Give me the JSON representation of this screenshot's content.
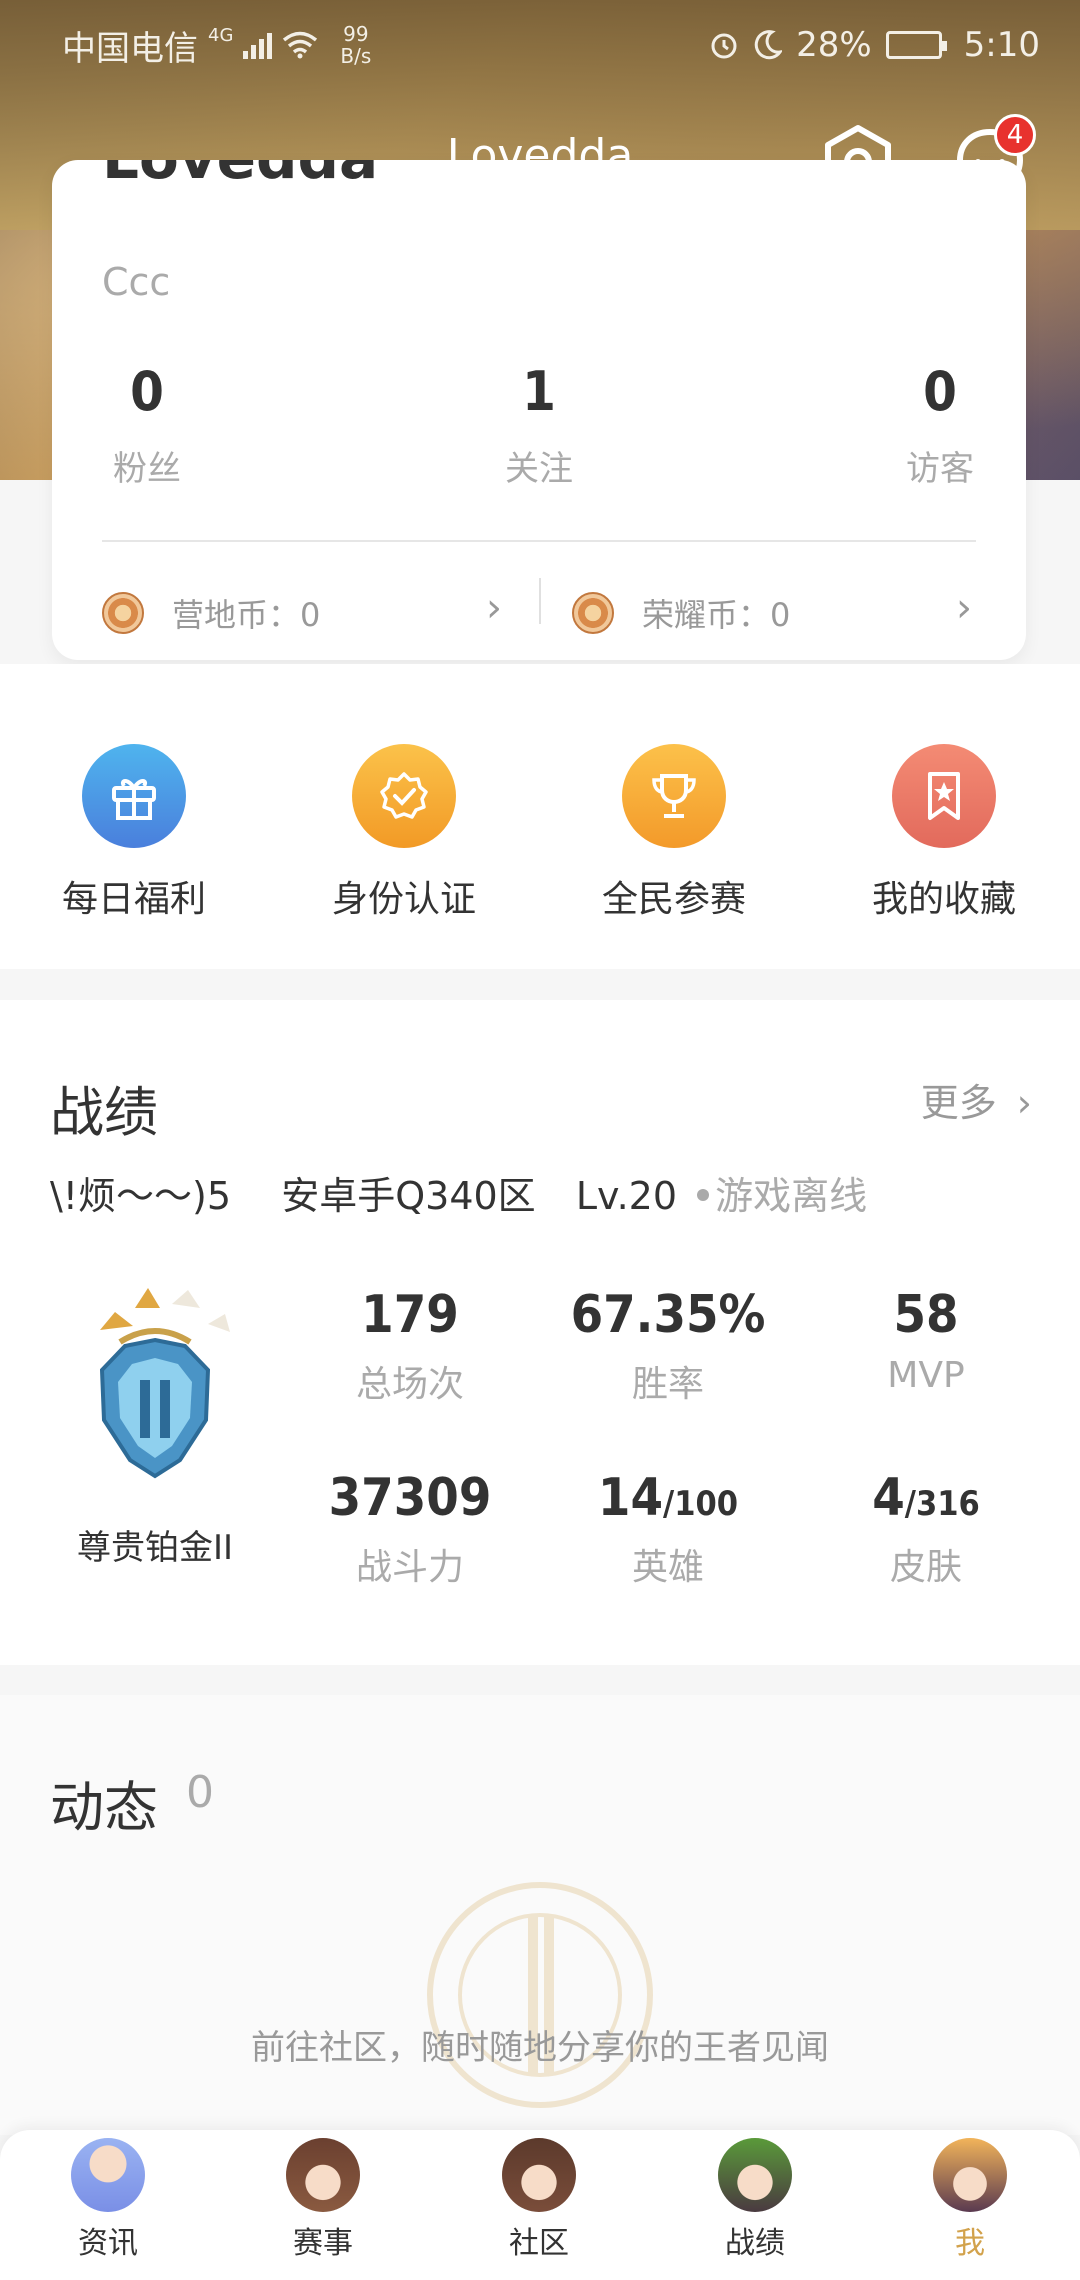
{
  "status_bar": {
    "carrier": "中国电信",
    "network": "4G",
    "speed_value": "99",
    "speed_unit": "B/s",
    "battery": "28%",
    "time": "5:10"
  },
  "header": {
    "title": "Lovedda",
    "message_badge": "4"
  },
  "profile": {
    "name": "Lovedda",
    "signature": "Ccc",
    "stats": [
      {
        "value": "0",
        "label": "粉丝"
      },
      {
        "value": "1",
        "label": "关注"
      },
      {
        "value": "0",
        "label": "访客"
      }
    ],
    "coins": [
      {
        "label": "营地币：0"
      },
      {
        "label": "荣耀币：0"
      }
    ]
  },
  "quick_actions": [
    {
      "label": "每日福利",
      "icon": "gift-icon",
      "color": "#4a8fe0"
    },
    {
      "label": "身份认证",
      "icon": "verified-badge-icon",
      "color": "#f5a52a"
    },
    {
      "label": "全民参赛",
      "icon": "trophy-icon",
      "color": "#f6a530"
    },
    {
      "label": "我的收藏",
      "icon": "bookmark-star-icon",
      "color": "#ee7a5e"
    }
  ],
  "record": {
    "title": "战绩",
    "more": "更多",
    "player_name": "\\!烦～～)5",
    "server": "安卓手Q340区",
    "level": "Lv.20",
    "status": "游戏离线",
    "rank_name": "尊贵铂金II",
    "rank_stars": 2,
    "rank_stars_total": 4,
    "stats": [
      {
        "value": "179",
        "label": "总场次"
      },
      {
        "value": "67.35%",
        "label": "胜率"
      },
      {
        "value": "58",
        "label": "MVP"
      },
      {
        "value": "37309",
        "label": "战斗力"
      },
      {
        "value": "14",
        "suffix": "/100",
        "label": "英雄"
      },
      {
        "value": "4",
        "suffix": "/316",
        "label": "皮肤"
      }
    ]
  },
  "feed": {
    "title": "动态",
    "count": "0",
    "empty_message": "前往社区，随时随地分享你的王者见闻"
  },
  "tabs": [
    {
      "label": "资讯",
      "active": false
    },
    {
      "label": "赛事",
      "active": false
    },
    {
      "label": "社区",
      "active": false
    },
    {
      "label": "战绩",
      "active": false
    },
    {
      "label": "我",
      "active": true
    }
  ],
  "colors": {
    "accent": "#d2a24c",
    "badge": "#e8322e"
  }
}
